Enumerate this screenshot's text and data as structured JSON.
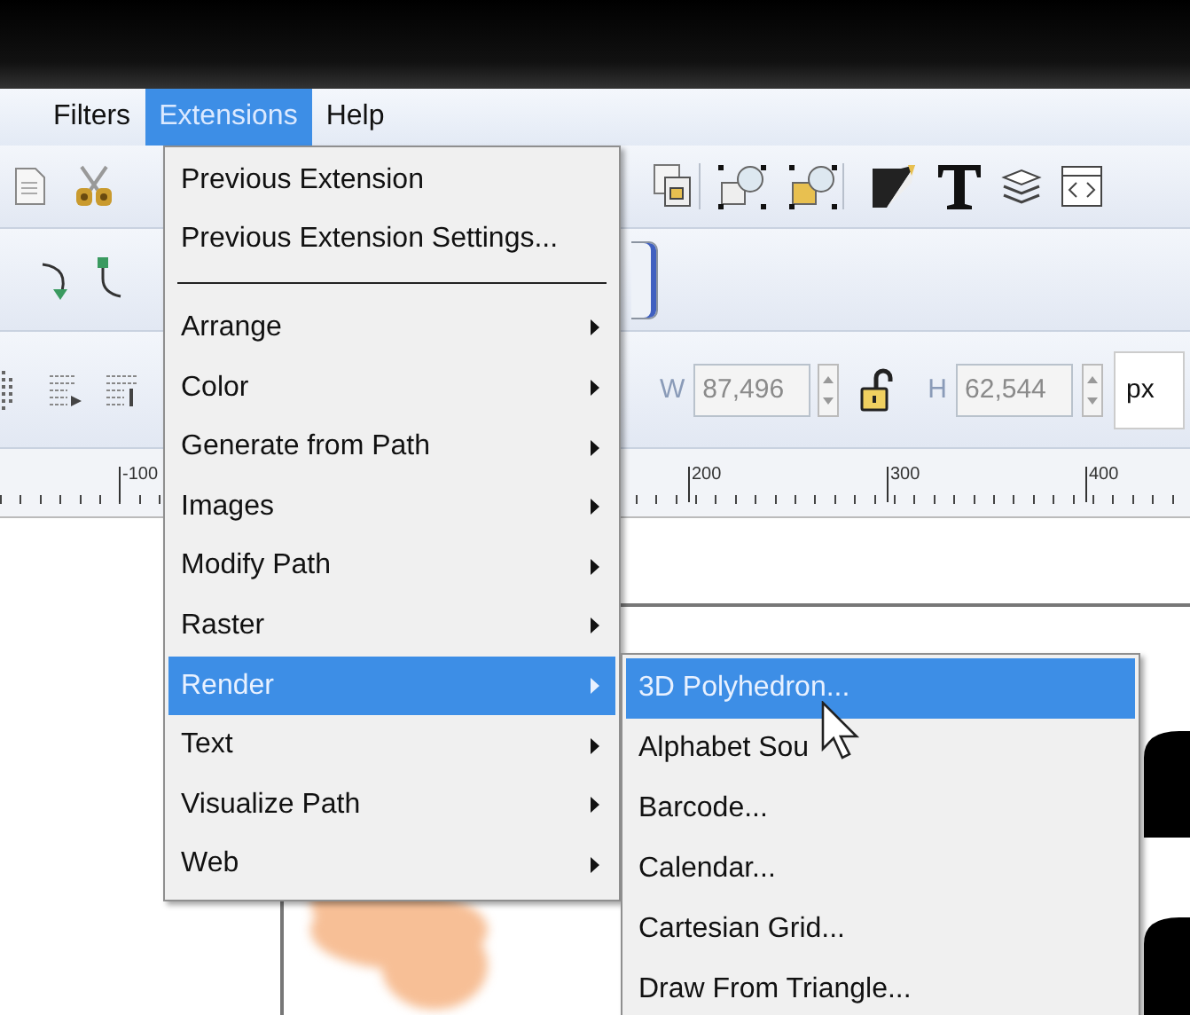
{
  "menu_bar": [
    {
      "label": "Filters",
      "selected": false
    },
    {
      "label": "Extensions",
      "selected": true
    },
    {
      "label": "Help",
      "selected": false
    }
  ],
  "extensions_menu": {
    "items": [
      {
        "kind": "item",
        "label": "Previous Extension",
        "selected": false
      },
      {
        "kind": "item",
        "label": "Previous Extension Settings...",
        "selected": false
      },
      {
        "kind": "separator"
      },
      {
        "kind": "submenu",
        "label": "Arrange",
        "selected": false
      },
      {
        "kind": "submenu",
        "label": "Color",
        "selected": false
      },
      {
        "kind": "submenu",
        "label": "Generate from Path",
        "selected": false
      },
      {
        "kind": "submenu",
        "label": "Images",
        "selected": false
      },
      {
        "kind": "submenu",
        "label": "Modify Path",
        "selected": false
      },
      {
        "kind": "submenu",
        "label": "Raster",
        "selected": false
      },
      {
        "kind": "submenu",
        "label": "Render",
        "selected": true
      },
      {
        "kind": "submenu",
        "label": "Text",
        "selected": false
      },
      {
        "kind": "submenu",
        "label": "Visualize Path",
        "selected": false
      },
      {
        "kind": "submenu",
        "label": "Web",
        "selected": false
      }
    ]
  },
  "render_submenu": {
    "items": [
      {
        "kind": "item",
        "label": "3D Polyhedron...",
        "selected": true
      },
      {
        "kind": "item",
        "label": "Alphabet Sou",
        "selected": false
      },
      {
        "kind": "item",
        "label": "Barcode...",
        "selected": false
      },
      {
        "kind": "item",
        "label": "Calendar...",
        "selected": false
      },
      {
        "kind": "item",
        "label": "Cartesian Grid...",
        "selected": false
      },
      {
        "kind": "item",
        "label": "Draw From Triangle...",
        "selected": false
      }
    ]
  },
  "dimensions_toolbar": {
    "width_label": "W",
    "width_value": "87,496",
    "height_label": "H",
    "height_value": "62,544",
    "unit": "px"
  },
  "ruler": {
    "labels": [
      "-100",
      "200",
      "300",
      "400"
    ]
  }
}
